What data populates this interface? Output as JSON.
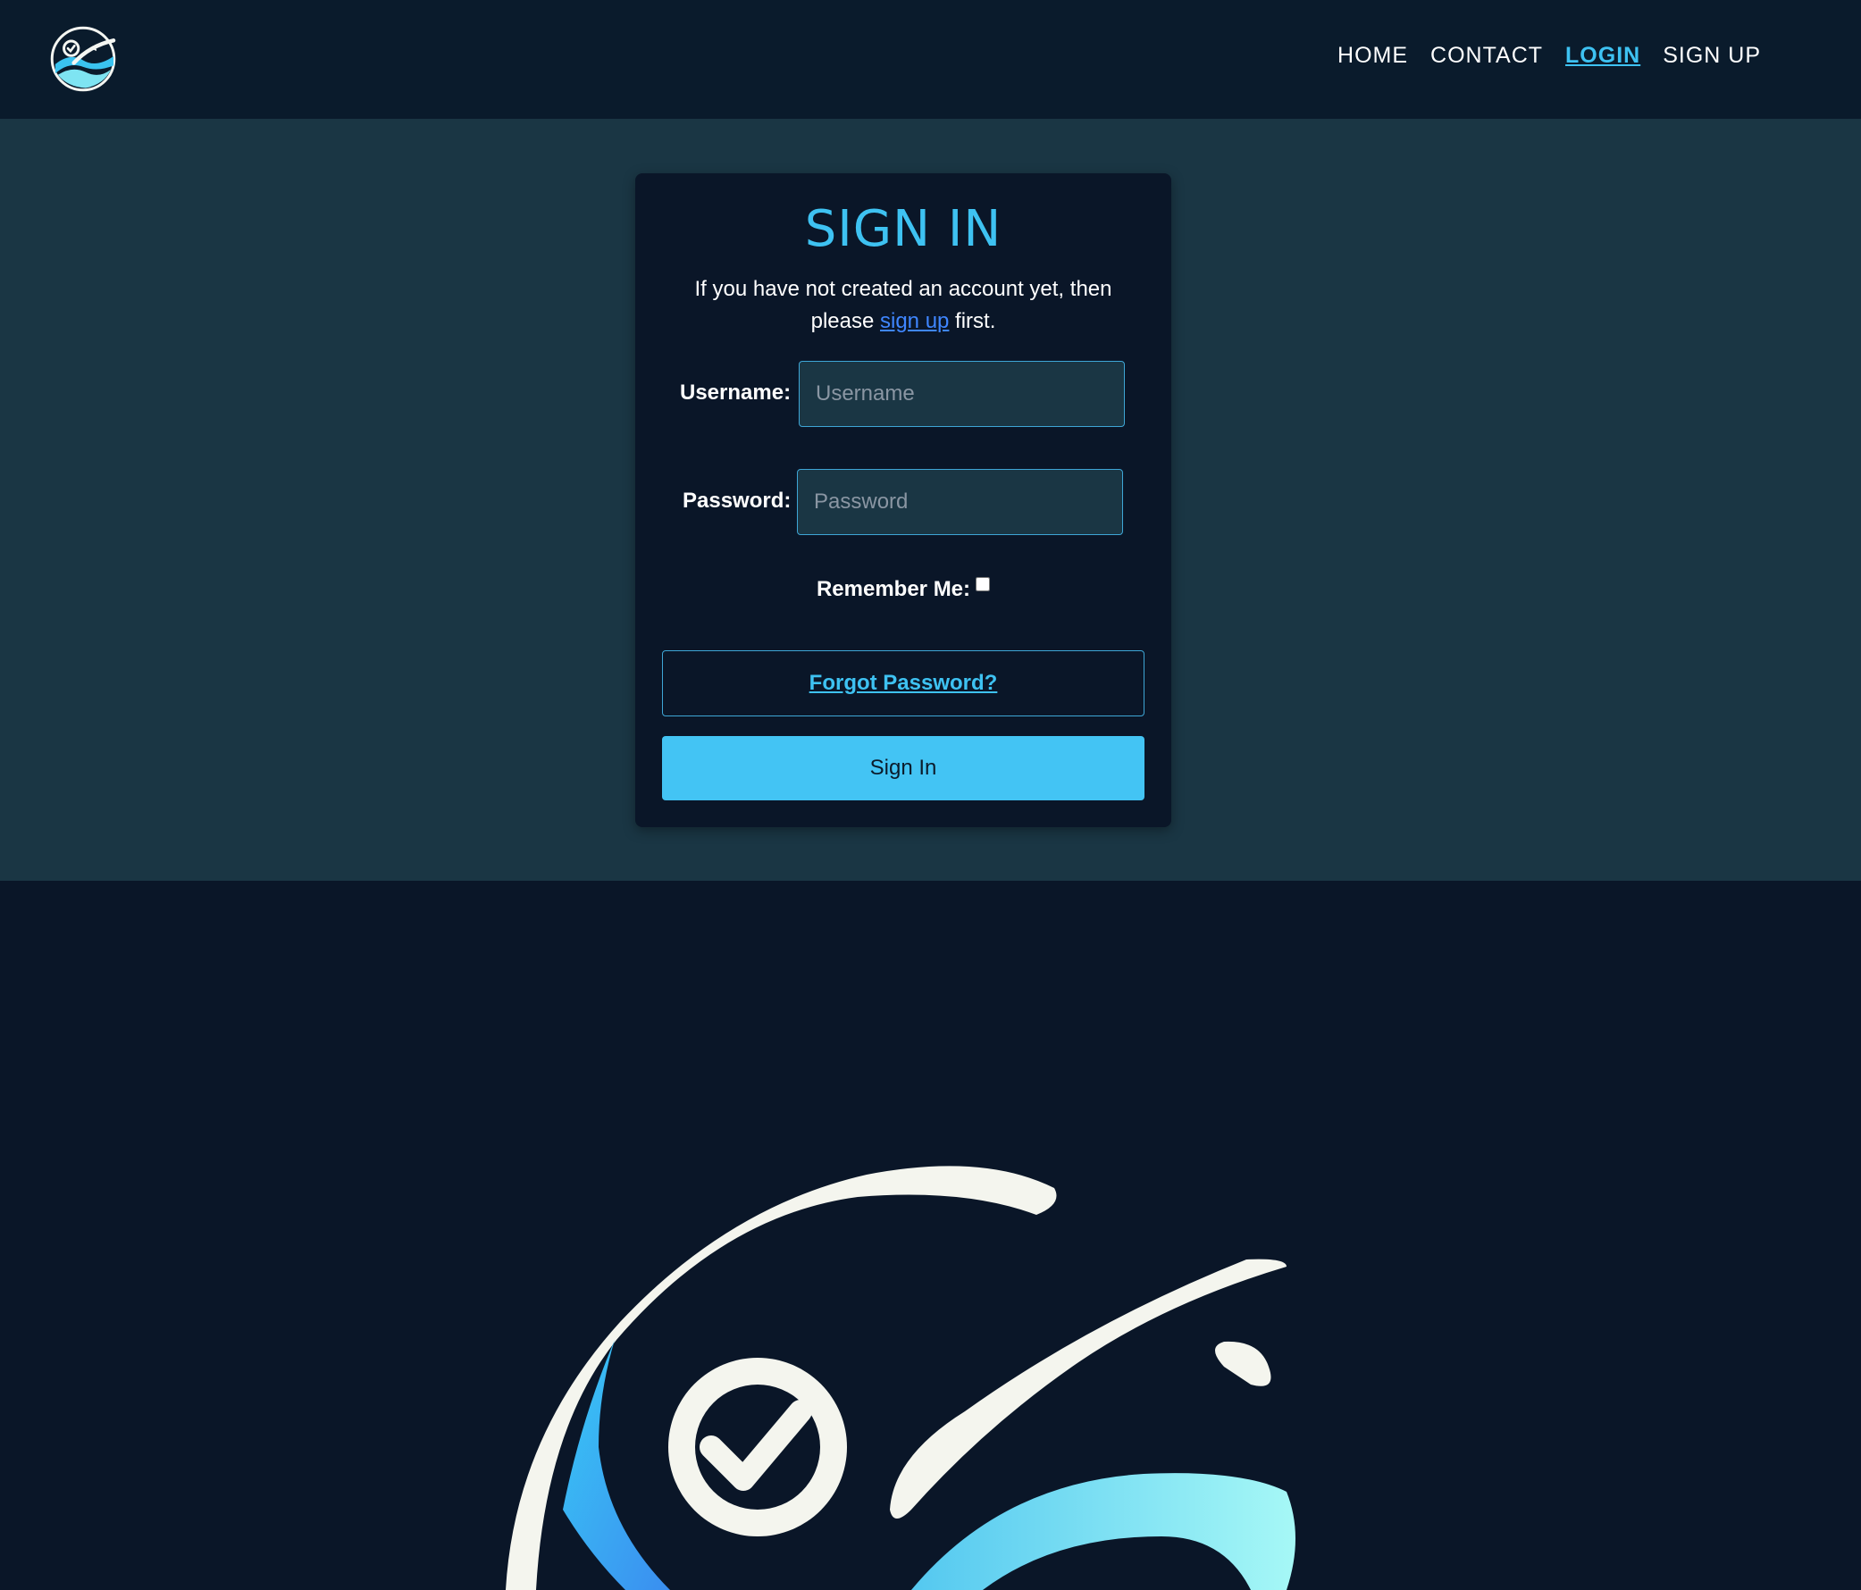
{
  "nav": {
    "links": [
      "HOME",
      "CONTACT",
      "LOGIN",
      "SIGN UP"
    ],
    "active": "LOGIN"
  },
  "login_card": {
    "title": "SIGN IN",
    "intro_before": "If you have not created an account yet, then please ",
    "intro_link": "sign up",
    "intro_after": " first.",
    "username_label": "Username:",
    "username_placeholder": "Username",
    "password_label": "Password:",
    "password_placeholder": "Password",
    "remember_label": "Remember Me:",
    "remember_checked": false,
    "forgot_label": "Forgot Password?",
    "signin_label": "Sign In"
  },
  "colors": {
    "navbar_bg": "#0a1b2c",
    "band_bg": "#1a3644",
    "card_bg": "#0a1628",
    "accent": "#3ec2f2",
    "link": "#3f86ff"
  },
  "icons": {
    "nav_logo": "wave-checkmark-logo-icon",
    "hero": "wave-checkmark-logo-icon"
  }
}
